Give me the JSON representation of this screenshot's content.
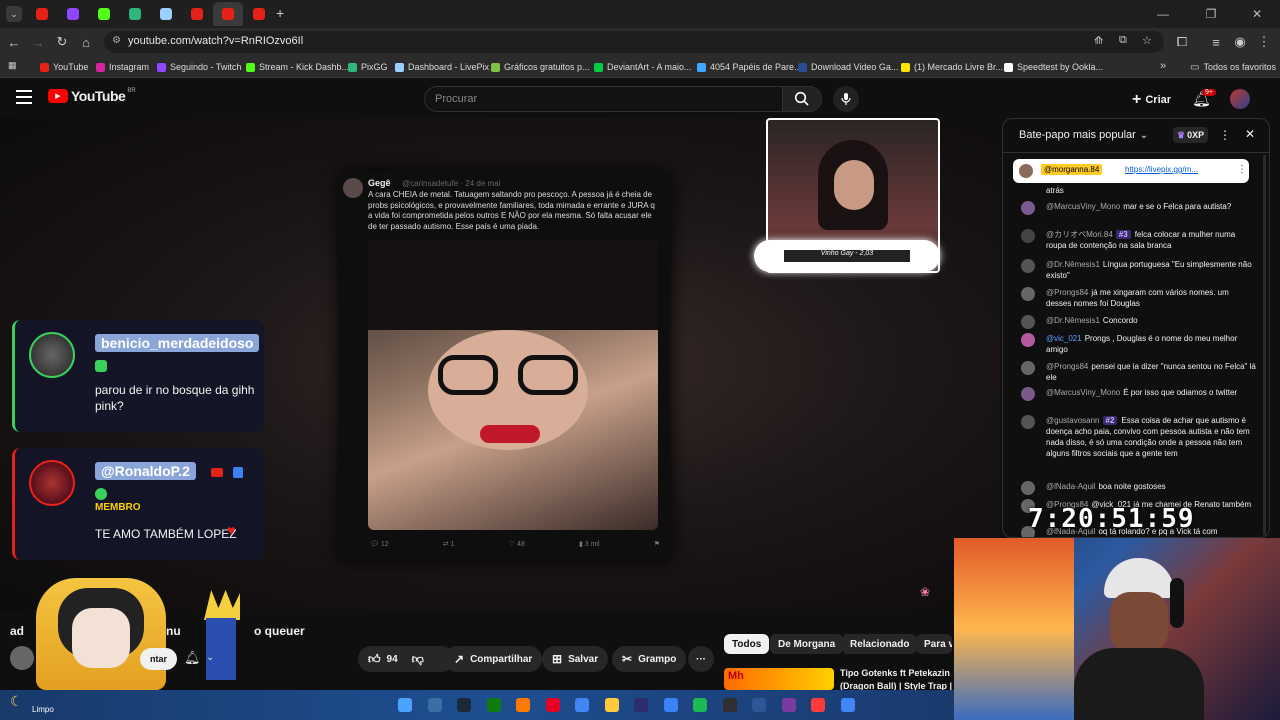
{
  "browser": {
    "url": "youtube.com/watch?v=RnRIOzvo6Il",
    "tabs": [
      {
        "color": "#e62117"
      },
      {
        "color": "#9146ff"
      },
      {
        "color": "#53fc18"
      },
      {
        "color": "#2fb67c"
      },
      {
        "color": "#9ad0ff"
      },
      {
        "color": "#e62117"
      },
      {
        "color": "#e62117"
      },
      {
        "color": "#e62117"
      }
    ],
    "new_tab_label": "+",
    "bookmarks": [
      {
        "label": "YouTube",
        "color": "#e62117"
      },
      {
        "label": "Instagram",
        "color": "#d6249f"
      },
      {
        "label": "Seguindo - Twitch",
        "color": "#9146ff"
      },
      {
        "label": "Stream - Kick Dashb...",
        "color": "#53fc18"
      },
      {
        "label": "PixGG",
        "color": "#2fb67c"
      },
      {
        "label": "Dashboard - LivePix",
        "color": "#9ad0ff"
      },
      {
        "label": "Gráficos gratuitos p...",
        "color": "#7ec04a"
      },
      {
        "label": "DeviantArt - A maio...",
        "color": "#05cc47"
      },
      {
        "label": "4054 Papéis de Pare...",
        "color": "#3ca8ff"
      },
      {
        "label": "Download Video Ga...",
        "color": "#2a4d8f"
      },
      {
        "label": "(1) Mercado Livre Br...",
        "color": "#ffe600"
      },
      {
        "label": "Speedtest by Ookla...",
        "color": "#ffffff"
      }
    ],
    "bookmarks_more": "»",
    "all_favorites": "Todos os favoritos"
  },
  "youtube": {
    "logo_text": "YouTube",
    "region": "BR",
    "search_placeholder": "Procurar",
    "create_label": "Criar",
    "notif_count": "9+"
  },
  "video": {
    "tweet": {
      "author": "Gegê",
      "handle": "@carinsadetufe · 24 de mai",
      "text": "A cara CHEIA de metal. Tatuagem saltando pro pescoço. A pessoa já é cheia de probs psicológicos, e provavelmente familiares, toda mimada e errante e JURA q a vida foi comprometida pelos outros E NÃO por ela mesma. Só falta acusar ele de ter passado autismo. Esse país é uma piada.",
      "replies": "12",
      "retweets": "1",
      "likes": "48",
      "views": "3 mil"
    },
    "cam_caption": "Vinho Gay - 2,03",
    "chat_cards": [
      {
        "name": "benicio_merdadeidoso",
        "message": "parou de ir no bosque da gihh pink?",
        "accent": "#3ad15c"
      },
      {
        "name": "@RonaldoP.2",
        "badge": "MEMBRO",
        "message": "TE AMO TAMBÉM LOPEZ",
        "accent": "#e62117"
      }
    ]
  },
  "below_video": {
    "channel_snippet": "ad",
    "title_snippet": "nu",
    "title_snippet2": "o que",
    "title_snippet3": "uer",
    "subscribe_fragment": "ntar",
    "like_count": "94",
    "share_label": "Compartilhar",
    "save_label": "Salvar",
    "clip_label": "Grampo",
    "more_label": "···"
  },
  "related": {
    "chips": [
      "Todos",
      "De Morgana",
      "Relacionado",
      "Para vo"
    ],
    "video_title": "Tipo Gotenks ft Petekazin",
    "video_subtitle": "(Dragon Ball) | Style Trap | L"
  },
  "chat": {
    "title": "Bate-papo mais popular",
    "points": "0XP",
    "pinned": {
      "author": "@morganna.84",
      "link": "https://livepix.gg/m..."
    },
    "messages": [
      {
        "author": "",
        "text": "atrás",
        "color": "#888"
      },
      {
        "author": "@MarcusViny_Mono",
        "text": "mar e se o Felca para autista?",
        "color": "#7a5a8a"
      },
      {
        "author": "@カリオペMori.84",
        "badge": "#3",
        "text": "felca colocar a mulher numa roupa de contenção na sala branca",
        "color": "#444"
      },
      {
        "author": "@Dr.Nêmesis1",
        "text": "Língua portuguesa \"Eu simplesmente não existo\"",
        "color": "#555"
      },
      {
        "author": "@Prongs84",
        "text": "já me xingaram com vários nomes. um desses nomes foi Douglas",
        "color": "#666"
      },
      {
        "author": "@Dr.Nêmesis1",
        "text": "Concordo",
        "color": "#555"
      },
      {
        "author": "@vic_021",
        "text": "Prongs , Douglas é o nome do meu melhor amigo",
        "color": "#b45aa0",
        "author_color": "#5e9dff"
      },
      {
        "author": "@Prongs84",
        "text": "pensei que ia dizer \"nunca sentou no Felca\" lá ele",
        "color": "#666"
      },
      {
        "author": "@MarcusViny_Mono",
        "text": "É por isso que odiamos o twitter",
        "color": "#7a5a8a"
      },
      {
        "author": "@gustavosann",
        "badge": "#2",
        "text": "Essa coisa de achar que autismo é doença acho paia, convivo com pessoa autista e não tem nada disso, é só uma condição onde a pessoa não tem alguns filtros sociais que a gente tem",
        "color": "#555"
      },
      {
        "author": "@lNada-Aquil",
        "text": "boa noite gostoses",
        "color": "#666"
      },
      {
        "author": "@Prongs84",
        "text": "@vick_021 já me chamei de Renato também",
        "color": "#666"
      },
      {
        "author": "@lNada-Aquil",
        "text": "oq tá rolando? e pq a Vick tá com",
        "color": "#666"
      }
    ]
  },
  "overlay": {
    "clock": "7:20:51:59"
  },
  "taskbar": {
    "weather": "Limpo",
    "icons": [
      {
        "name": "windows-icon",
        "color": "#4aa3ff"
      },
      {
        "name": "search-taskbar-icon",
        "color": "#3a6ea5"
      },
      {
        "name": "steam-icon",
        "color": "#1b2838"
      },
      {
        "name": "xbox-icon",
        "color": "#107c10"
      },
      {
        "name": "app-a-icon",
        "color": "#ff7a00"
      },
      {
        "name": "pinterest-icon",
        "color": "#e60023"
      },
      {
        "name": "chrome-icon",
        "color": "#4285f4"
      },
      {
        "name": "folder-icon",
        "color": "#ffc83d"
      },
      {
        "name": "terminal-icon",
        "color": "#2d2d6d"
      },
      {
        "name": "notes-icon",
        "color": "#3b82f6"
      },
      {
        "name": "spotify-icon",
        "color": "#1db954"
      },
      {
        "name": "obs-icon",
        "color": "#302e31"
      },
      {
        "name": "app-b-icon",
        "color": "#2b5797"
      },
      {
        "name": "app-c-icon",
        "color": "#7a3aa0"
      },
      {
        "name": "app-d-icon",
        "color": "#ff3b3b"
      },
      {
        "name": "chrome2-icon",
        "color": "#4285f4"
      }
    ]
  }
}
